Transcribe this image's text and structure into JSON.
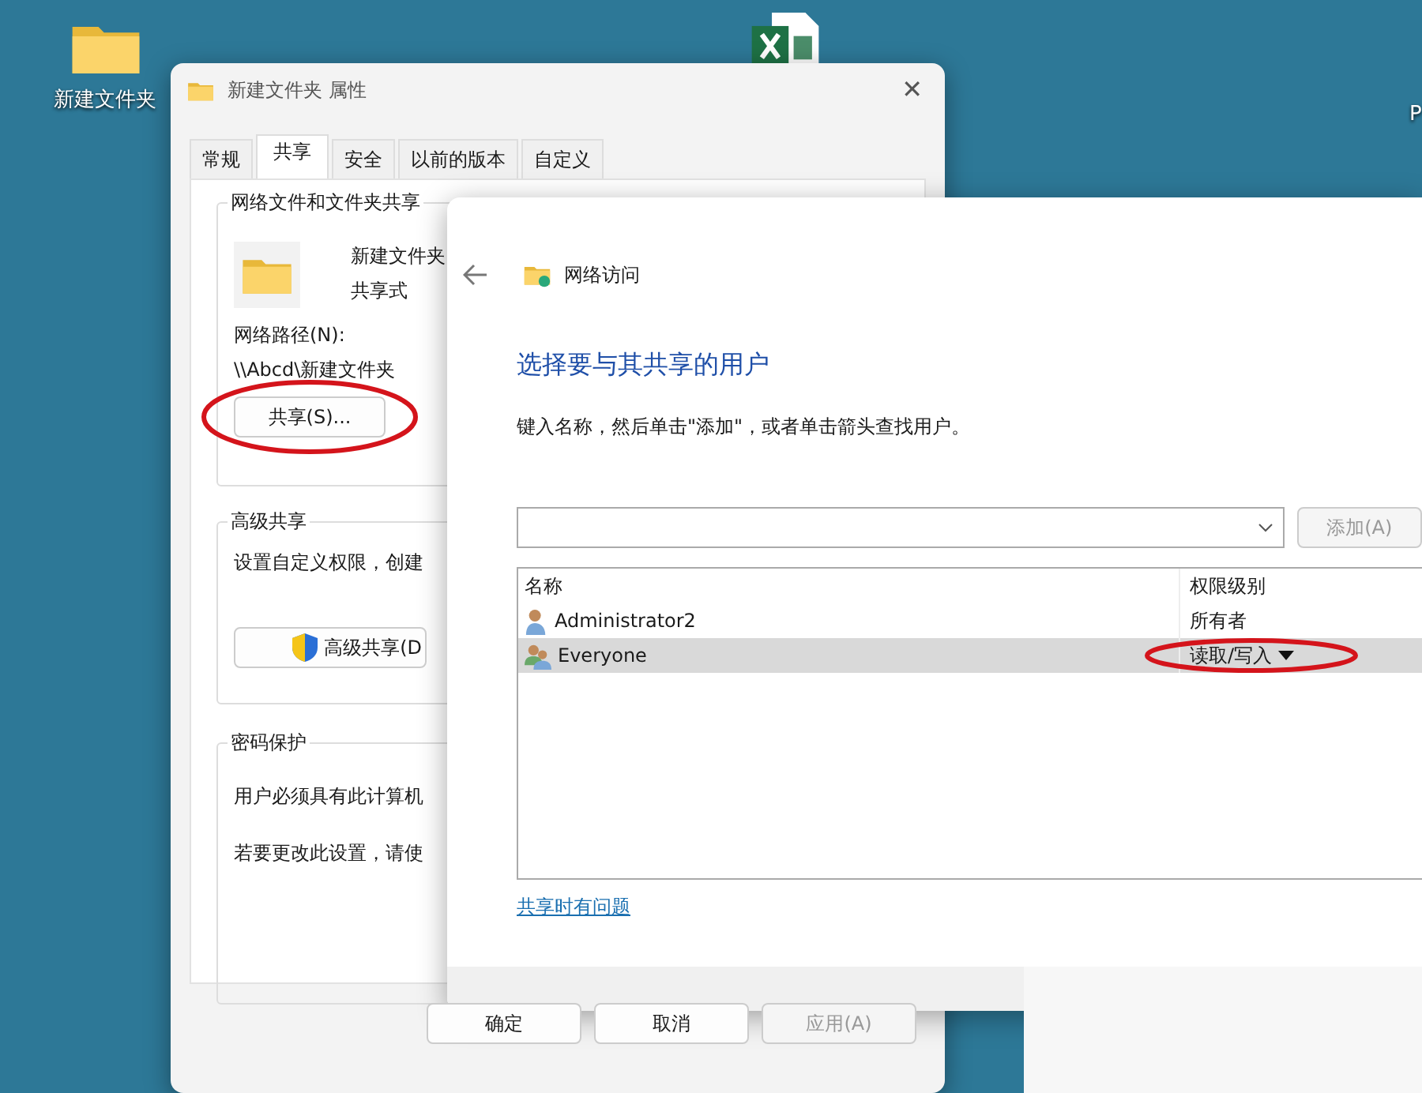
{
  "desktop": {
    "icons": [
      {
        "label": "新建文件夹",
        "kind": "folder"
      },
      {
        "kind": "spreadsheet"
      }
    ],
    "edge_text": "P"
  },
  "properties_window": {
    "title": "新建文件夹 属性",
    "close": "✕",
    "tabs": [
      {
        "label": "常规",
        "selected": false
      },
      {
        "label": "共享",
        "selected": true
      },
      {
        "label": "安全",
        "selected": false
      },
      {
        "label": "以前的版本",
        "selected": false
      },
      {
        "label": "自定义",
        "selected": false
      }
    ],
    "sharing_group": {
      "title": "网络文件和文件夹共享",
      "folder_name": "新建文件夹",
      "folder_state": "共享式",
      "path_label": "网络路径(N):",
      "path": "\\\\Abcd\\新建文件夹",
      "share_button": "共享(S)..."
    },
    "advanced_group": {
      "title": "高级共享",
      "text": "设置自定义权限，创建",
      "button": "高级共享(D"
    },
    "password_group": {
      "title": "密码保护",
      "lines": [
        "用户必须具有此计算机",
        "若要更改此设置，请使"
      ]
    },
    "buttons": [
      {
        "label": "确定",
        "disabled": false
      },
      {
        "label": "取消",
        "disabled": false
      },
      {
        "label": "应用(A)",
        "disabled": true
      }
    ]
  },
  "network_dialog": {
    "title": "网络访问",
    "heading": "选择要与其共享的用户",
    "instruction": "键入名称，然后单击\"添加\"，或者单击箭头查找用户。",
    "add_button": {
      "label": "添加(A)",
      "disabled": true
    },
    "columns": [
      "名称",
      "权限级别"
    ],
    "rows": [
      {
        "name": "Administrator2",
        "kind": "user",
        "permission": "所有者",
        "selected": false
      },
      {
        "name": "Everyone",
        "kind": "group",
        "permission": "读取/写入",
        "selected": true
      }
    ],
    "help_link": "共享时有问题"
  }
}
